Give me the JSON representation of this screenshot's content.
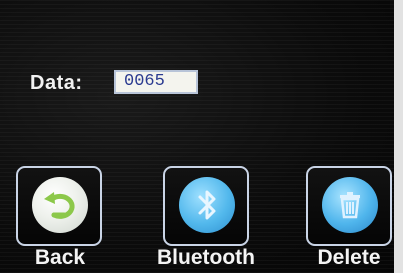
{
  "data_field": {
    "label": "Data:",
    "value": "0065"
  },
  "buttons": {
    "back": {
      "label": "Back",
      "icon": "back-arrow-icon"
    },
    "bluetooth": {
      "label": "Bluetooth",
      "icon": "bluetooth-icon"
    },
    "delete": {
      "label": "Delete",
      "icon": "trash-icon"
    }
  },
  "colors": {
    "screen_bg": "#0b0b0b",
    "text": "#f2f2f2",
    "value_text": "#2a3a90",
    "button_border": "#c9d4e6",
    "back_circle": "#eef1ec",
    "bluetooth_circle": "#52b8ec",
    "delete_circle": "#4fb5ec",
    "back_arrow": "#8cc84a"
  }
}
